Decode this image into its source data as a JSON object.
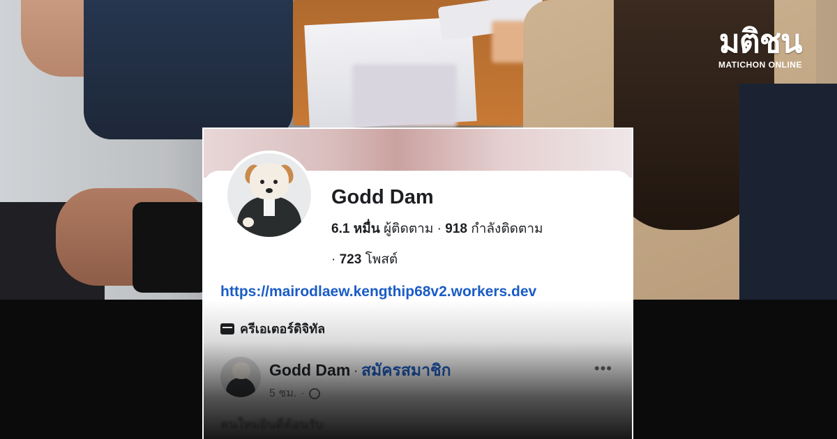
{
  "logo": {
    "mark": "มติชน",
    "subtitle": "MATICHON ONLINE"
  },
  "profile": {
    "name": "Godd Dam",
    "followers_value": "6.1 หมื่น",
    "followers_label": "ผู้ติดตาม",
    "following_value": "918",
    "following_label": "กำลังติดตาม",
    "posts_value": "723",
    "posts_label": "โพสต์",
    "link": "https://mairodlaew.kengthip68v2.workers.dev",
    "category": "ครีเอเตอร์ดิจิทัล",
    "avatar_icon": "dog-in-suit-avatar"
  },
  "post": {
    "author": "Godd Dam",
    "action": "สมัครสมาชิก",
    "time": "5 ชม.",
    "privacy_icon": "globe-icon",
    "more_icon": "more-options-icon",
    "text": "คนใหม่ยินดีต้อนรับ"
  },
  "colors": {
    "link_blue": "#1a5cc4",
    "text_dark": "#1c1e21",
    "muted": "#65676b"
  }
}
